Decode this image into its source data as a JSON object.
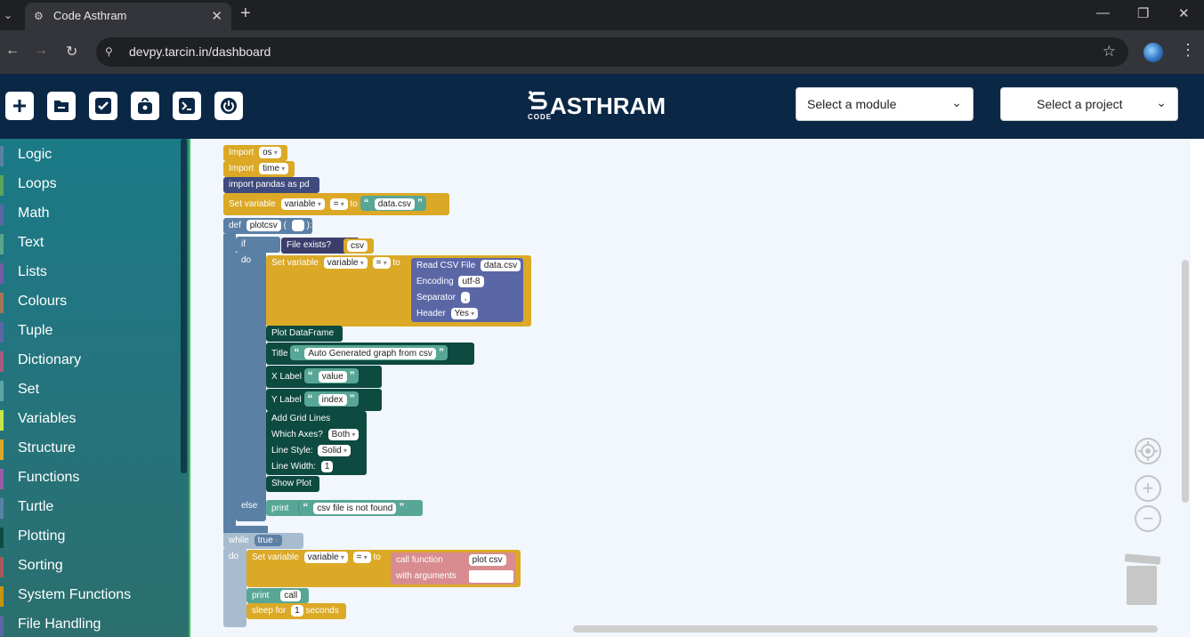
{
  "browser": {
    "tab_title": "Code Asthram",
    "url": "devpy.tarcin.in/dashboard",
    "icons": [
      "tab-list-icon",
      "new-tab-icon",
      "minimize-icon",
      "restore-icon",
      "close-window-icon",
      "back-icon",
      "forward-icon",
      "reload-icon",
      "site-info-icon",
      "bookmark-star-icon",
      "profile-avatar-icon",
      "menu-icon"
    ]
  },
  "toolbar": {
    "buttons": [
      {
        "name": "new-file-button",
        "glyph": "+"
      },
      {
        "name": "open-folder-button",
        "glyph": "−"
      },
      {
        "name": "check-button",
        "glyph": "✓"
      },
      {
        "name": "save-bag-button",
        "glyph": "●"
      },
      {
        "name": "terminal-button",
        "glyph": ">_"
      },
      {
        "name": "power-button",
        "glyph": "⏻"
      }
    ],
    "logo_main": "ASTHRAM",
    "logo_sub": "CODE",
    "module_select": "Select a module",
    "project_select": "Select a project",
    "header_bg": "#0b2746"
  },
  "sidebar": {
    "categories": [
      {
        "label": "Logic",
        "color": "#5b80a5"
      },
      {
        "label": "Loops",
        "color": "#5ba55b"
      },
      {
        "label": "Math",
        "color": "#5b67a5"
      },
      {
        "label": "Text",
        "color": "#5ba58c"
      },
      {
        "label": "Lists",
        "color": "#745ba5"
      },
      {
        "label": "Colours",
        "color": "#a5745b"
      },
      {
        "label": "Tuple",
        "color": "#5b67a5"
      },
      {
        "label": "Dictionary",
        "color": "#a55b80"
      },
      {
        "label": "Set",
        "color": "#5ba5a5"
      },
      {
        "label": "Variables",
        "color": "#c8e64b"
      },
      {
        "label": "Structure",
        "color": "#dba926"
      },
      {
        "label": "Functions",
        "color": "#995ba5"
      },
      {
        "label": "Turtle",
        "color": "#5b80a5"
      },
      {
        "label": "Plotting",
        "color": "#0d4a40"
      },
      {
        "label": "Sorting",
        "color": "#a55b5b"
      },
      {
        "label": "System Functions",
        "color": "#c79412"
      },
      {
        "label": "File Handling",
        "color": "#5b67a5"
      }
    ]
  },
  "blocks": {
    "import1": {
      "kw": "Import",
      "val": "os"
    },
    "import2": {
      "kw": "Import",
      "val": "time"
    },
    "import3": "import pandas as pd",
    "setvar1": {
      "kw": "Set variable",
      "var": "variable",
      "op": "=",
      "to": "to",
      "str": "data.csv"
    },
    "def": {
      "kw": "def",
      "name": "plotcsv",
      "open": "(",
      "close": "):"
    },
    "if_kw": "if",
    "do_kw": "do",
    "else_kw": "else",
    "file_exists": {
      "kw": "File exists?",
      "arg": "csv"
    },
    "setvar2": {
      "kw": "Set variable",
      "var": "variable",
      "op": "=",
      "to": "to"
    },
    "read_csv": {
      "kw": "Read CSV File",
      "file": "data.csv",
      "enc_kw": "Encoding",
      "enc": "utf-8",
      "sep_kw": "Separator",
      "sep": ",",
      "hdr_kw": "Header",
      "hdr": "Yes"
    },
    "plot_df": "Plot DataFrame",
    "title": {
      "kw": "Title",
      "val": "Auto Generated graph from csv"
    },
    "xlabel": {
      "kw": "X Label",
      "val": "value"
    },
    "ylabel": {
      "kw": "Y Label",
      "val": "index"
    },
    "grid": {
      "kw": "Add Grid Lines",
      "axes_kw": "Which Axes?",
      "axes": "Both",
      "style_kw": "Line Style:",
      "style": "Solid",
      "width_kw": "Line Width:",
      "width": "1"
    },
    "show_plot": "Show Plot",
    "print_else": {
      "kw": "print",
      "val": "csv file is not found"
    },
    "while": {
      "kw": "while",
      "cond": "true",
      "do": "do"
    },
    "setvar3": {
      "kw": "Set variable",
      "var": "variable",
      "op": "=",
      "to": "to"
    },
    "call_fn": {
      "kw": "call function",
      "name": "plot csv",
      "args_kw": "with arguments"
    },
    "print_call": {
      "kw": "print",
      "val": "call"
    },
    "sleep": {
      "kw": "sleep for",
      "n": "1",
      "unit": "seconds"
    }
  },
  "workspace_controls": [
    "recenter-icon",
    "zoom-in-icon",
    "zoom-out-icon",
    "trash-icon"
  ]
}
